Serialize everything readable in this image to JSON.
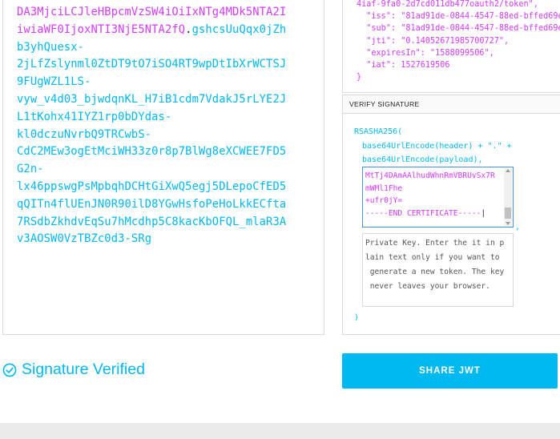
{
  "encoded": {
    "header_tail_lines": [],
    "payload_lines": [
      "DA3MjciLCJleHBpcmVzSW4iOiIxNTg4MDk5NTA2I",
      "iwiaWF0IjoxNTI3NjE5NTA2fQ"
    ],
    "dot": ".",
    "signature_first": "gshcsUuQqx0jZh",
    "signature_lines": [
      "b3yhQuesx-",
      "2jLfZslynml0ZtDT9tO7iSO4RT9wpDtIbXrWCTSJ",
      "9FUgWZL1LS-",
      "vyw_v4d03_bjwdqnKL_H7iB1cdm7VdakJ5rLYE2J",
      "L1tKohx41IYZ1rp0bDYdas-",
      "kl0dczuNvrbQ9TRCwbS-",
      "CdC2MEw3ogEtMciWH33z0r8p7BlWg8eXCWEE7FD5",
      "G2n-",
      "lx46ppswgPsMpbqhDCHtGiXwQ5egj5DLepoCfED5",
      "qQITn4flUEnJN0R90ilD8YGwHsfoPeHoLkkECfta",
      "7RSdbZkhdvEqSu7hMcdhp5C8kacKbOFQL_mlaR3A",
      "v3AOSW0VzTBZc0d3-SRg"
    ]
  },
  "payload": {
    "top_cut_line": "4iaf-9fa0-2d7cd011db477oauth2/token\",",
    "fields": [
      {
        "key": "\"iss\"",
        "value": "\"81ad91de-0844-4547-88ed-bffed69e"
      },
      {
        "key": "\"sub\"",
        "value": "\"81ad91de-0844-4547-88ed-bffed69e"
      },
      {
        "key": "\"jti\"",
        "value": "\"0.14052671985700727\","
      },
      {
        "key": "\"expiresIn\"",
        "value": "\"1588099506\","
      },
      {
        "key": "\"iat\"",
        "value": "1527619506"
      }
    ],
    "close_brace": "}"
  },
  "verify": {
    "title": "VERIFY SIGNATURE",
    "algo_line": "RSASHA256(",
    "header_line": "base64UrlEncode(header) + \".\" +",
    "payload_line": "base64UrlEncode(payload),",
    "cert_lines": [
      "MtTj4DAmAAlhudWhnRmVBRUvSx7R",
      "mWMl1Fhe",
      "+ufr0jY=",
      "-----END CERTIFICATE-----"
    ],
    "comma": ",",
    "key_placeholder": "Private Key. Enter the it in p\nlain text only if you want to\n generate a new token. The key\n never leaves your browser.",
    "close_paren": ")"
  },
  "status": {
    "verified_label": "Signature Verified"
  },
  "actions": {
    "share_label": "SHARE JWT"
  },
  "colors": {
    "accent": "#00b9f1",
    "payload": "#d63aff"
  }
}
